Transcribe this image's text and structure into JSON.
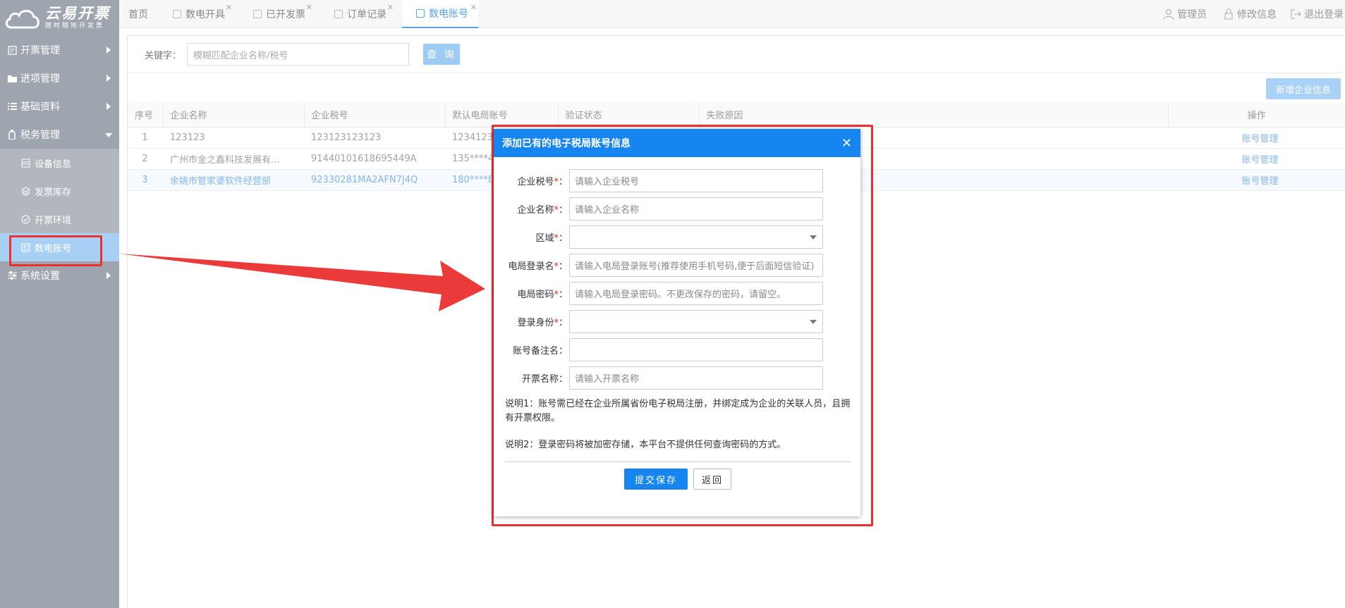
{
  "logo": {
    "title": "云易开票",
    "subtitle": "随时随地开发票"
  },
  "sidebar": {
    "items": [
      {
        "label": "开票管理",
        "icon": "invoice-icon"
      },
      {
        "label": "进项管理",
        "icon": "folder-icon"
      },
      {
        "label": "基础资料",
        "icon": "list-icon"
      },
      {
        "label": "税务管理",
        "icon": "bottle-icon"
      }
    ],
    "sub_items": [
      {
        "label": "设备信息",
        "icon": "device-icon"
      },
      {
        "label": "发票库存",
        "icon": "stack-icon"
      },
      {
        "label": "开票环境",
        "icon": "check-circle-icon"
      },
      {
        "label": "数电账号",
        "icon": "account-icon"
      }
    ],
    "settings": {
      "label": "系统设置",
      "icon": "sliders-icon"
    }
  },
  "tabs": [
    {
      "label": "首页"
    },
    {
      "label": "数电开具"
    },
    {
      "label": "已开发票"
    },
    {
      "label": "订单记录"
    },
    {
      "label": "数电账号"
    }
  ],
  "header_right": {
    "admin": "管理员",
    "edit": "修改信息",
    "logout": "退出登录"
  },
  "search": {
    "label": "关键字：",
    "placeholder": "模糊匹配企业名称/税号",
    "button": "查 询"
  },
  "toolbar": {
    "add_label": "新增企业信息"
  },
  "table": {
    "headers": [
      "序号",
      "企业名称",
      "企业税号",
      "默认电局账号",
      "验证状态",
      "失败原因",
      "操作"
    ],
    "rows": [
      {
        "no": "1",
        "name": "123123",
        "tax": "123123123123",
        "account": "1234123",
        "status": "",
        "reason": "",
        "op": "账号管理"
      },
      {
        "no": "2",
        "name": "广州市金之鑫科技发展有...",
        "tax": "91440101618695449A",
        "account": "135****4",
        "status": "",
        "reason": "",
        "op": "账号管理"
      },
      {
        "no": "3",
        "name": "余姚市管家婆软件经营部",
        "tax": "92330281MA2AFN7J4Q",
        "account": "180****8",
        "status": "",
        "reason": "",
        "op": "账号管理"
      }
    ]
  },
  "modal": {
    "title": "添加已有的电子税局账号信息",
    "fields": [
      {
        "label": "企业税号",
        "required": "*",
        "placeholder": "请输入企业税号"
      },
      {
        "label": "企业名称",
        "required": "*",
        "placeholder": "请输入企业名称"
      },
      {
        "label": "区域",
        "required": "*",
        "placeholder": ""
      },
      {
        "label": "电局登录名",
        "required": "*",
        "placeholder": "请输入电局登录账号(推荐使用手机号码,便于后面短信验证)"
      },
      {
        "label": "电局密码",
        "required": "*",
        "placeholder": "请输入电局登录密码。不更改保存的密码，请留空。"
      },
      {
        "label": "登录身份",
        "required": "*",
        "placeholder": ""
      },
      {
        "label": "账号备注名",
        "required": "",
        "placeholder": ""
      },
      {
        "label": "开票名称",
        "required": "",
        "placeholder": "请输入开票名称"
      }
    ],
    "note1": "说明1：账号需已经在企业所属省份电子税局注册，并绑定成为企业的关联人员，且拥有开票权限。",
    "note2": "说明2：登录密码将被加密存储，本平台不提供任何查询密码的方式。",
    "submit": "提交保存",
    "back": "返回"
  },
  "colors": {
    "sidebar": "#9fa5af",
    "accent": "#1785ef",
    "highlight": "#ec2f2f"
  }
}
